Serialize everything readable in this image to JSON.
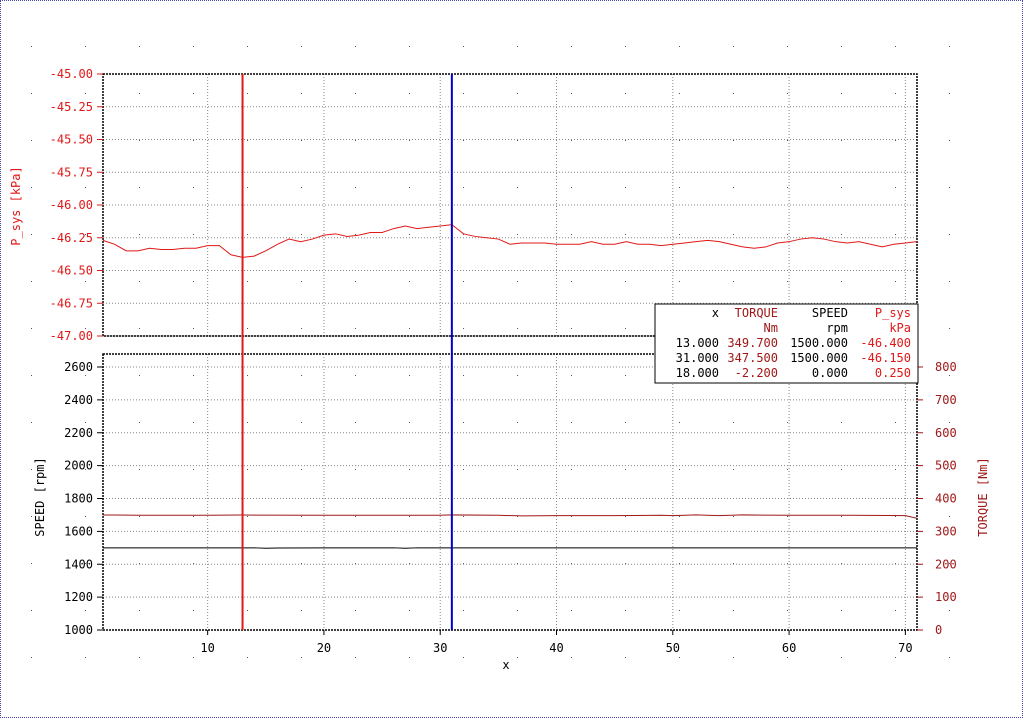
{
  "colors": {
    "torque": "#a01818",
    "psys": "#e01818",
    "speed": "#000000",
    "cursor1": "#e01818",
    "cursor2": "#0000cc",
    "grid": "#888888"
  },
  "chart_data": [
    {
      "type": "line",
      "panel": "top",
      "ylabel": "P_sys [kPa]",
      "ylim": [
        -47.0,
        -45.0
      ],
      "yticks": [
        "-45.00",
        "-45.25",
        "-45.50",
        "-45.75",
        "-46.00",
        "-46.25",
        "-46.50",
        "-46.75",
        "-47.00"
      ],
      "xlim": [
        1,
        71
      ],
      "series": [
        {
          "name": "P_sys",
          "x": [
            1,
            2,
            3,
            4,
            5,
            6,
            7,
            8,
            9,
            10,
            11,
            12,
            13,
            14,
            15,
            16,
            17,
            18,
            19,
            20,
            21,
            22,
            23,
            24,
            25,
            26,
            27,
            28,
            29,
            30,
            31,
            32,
            33,
            34,
            35,
            36,
            37,
            38,
            39,
            40,
            41,
            42,
            43,
            44,
            45,
            46,
            47,
            48,
            49,
            50,
            51,
            52,
            53,
            54,
            55,
            56,
            57,
            58,
            59,
            60,
            61,
            62,
            63,
            64,
            65,
            66,
            67,
            68,
            69,
            70,
            71
          ],
          "y": [
            -46.27,
            -46.3,
            -46.35,
            -46.35,
            -46.33,
            -46.34,
            -46.34,
            -46.33,
            -46.33,
            -46.31,
            -46.31,
            -46.38,
            -46.4,
            -46.39,
            -46.35,
            -46.3,
            -46.26,
            -46.28,
            -46.26,
            -46.23,
            -46.22,
            -46.24,
            -46.23,
            -46.21,
            -46.21,
            -46.18,
            -46.16,
            -46.18,
            -46.17,
            -46.16,
            -46.15,
            -46.22,
            -46.24,
            -46.25,
            -46.26,
            -46.3,
            -46.29,
            -46.29,
            -46.29,
            -46.3,
            -46.3,
            -46.3,
            -46.28,
            -46.3,
            -46.3,
            -46.28,
            -46.3,
            -46.3,
            -46.31,
            -46.3,
            -46.29,
            -46.28,
            -46.27,
            -46.28,
            -46.3,
            -46.32,
            -46.33,
            -46.32,
            -46.29,
            -46.28,
            -46.26,
            -46.25,
            -46.26,
            -46.28,
            -46.29,
            -46.28,
            -46.3,
            -46.32,
            -46.3,
            -46.29,
            -46.28
          ]
        }
      ]
    },
    {
      "type": "line",
      "panel": "bottom",
      "xlabel": "x",
      "ylabel": "SPEED [rpm]",
      "ylabel_right": "TORQUE [Nm]",
      "xlim": [
        1,
        71
      ],
      "xticks": [
        "10",
        "20",
        "30",
        "40",
        "50",
        "60",
        "70"
      ],
      "ylim": [
        1000,
        2700
      ],
      "yticks": [
        "2600",
        "2400",
        "2200",
        "2000",
        "1800",
        "1600",
        "1400",
        "1200",
        "1000"
      ],
      "ylim_right": [
        0,
        800
      ],
      "yticks_right": [
        "800",
        "700",
        "600",
        "500",
        "400",
        "300",
        "200",
        "100",
        "0"
      ],
      "series": [
        {
          "name": "SPEED",
          "axis": "left",
          "x": [
            1,
            5,
            10,
            14,
            15,
            16,
            20,
            25,
            26,
            27,
            28,
            30,
            40,
            50,
            60,
            71
          ],
          "y": [
            1500,
            1500,
            1500,
            1500,
            1497,
            1499,
            1500,
            1500,
            1500,
            1497,
            1500,
            1500,
            1500,
            1500,
            1500,
            1500
          ]
        },
        {
          "name": "TORQUE",
          "axis": "right",
          "x": [
            1,
            2,
            4,
            10,
            13,
            20,
            30,
            31,
            35,
            37,
            40,
            45,
            49,
            50,
            52,
            54,
            56,
            60,
            65,
            70,
            71
          ],
          "y": [
            350,
            350,
            349,
            349,
            349.7,
            349,
            349,
            350,
            349,
            347,
            348,
            348,
            349,
            348,
            350,
            348,
            350,
            349,
            349,
            348,
            340
          ]
        }
      ]
    }
  ],
  "cursors": [
    {
      "x": 13,
      "color": "cursor1"
    },
    {
      "x": 31,
      "color": "cursor2"
    }
  ],
  "cursor_table": {
    "headers": [
      "x",
      "TORQUE",
      "SPEED",
      "P_sys"
    ],
    "units": [
      "",
      "Nm",
      "rpm",
      "kPa"
    ],
    "rows": [
      [
        "13.000",
        "349.700",
        "1500.000",
        "-46.400"
      ],
      [
        "31.000",
        "347.500",
        "1500.000",
        "-46.150"
      ],
      [
        "18.000",
        "-2.200",
        "0.000",
        "0.250"
      ]
    ]
  }
}
